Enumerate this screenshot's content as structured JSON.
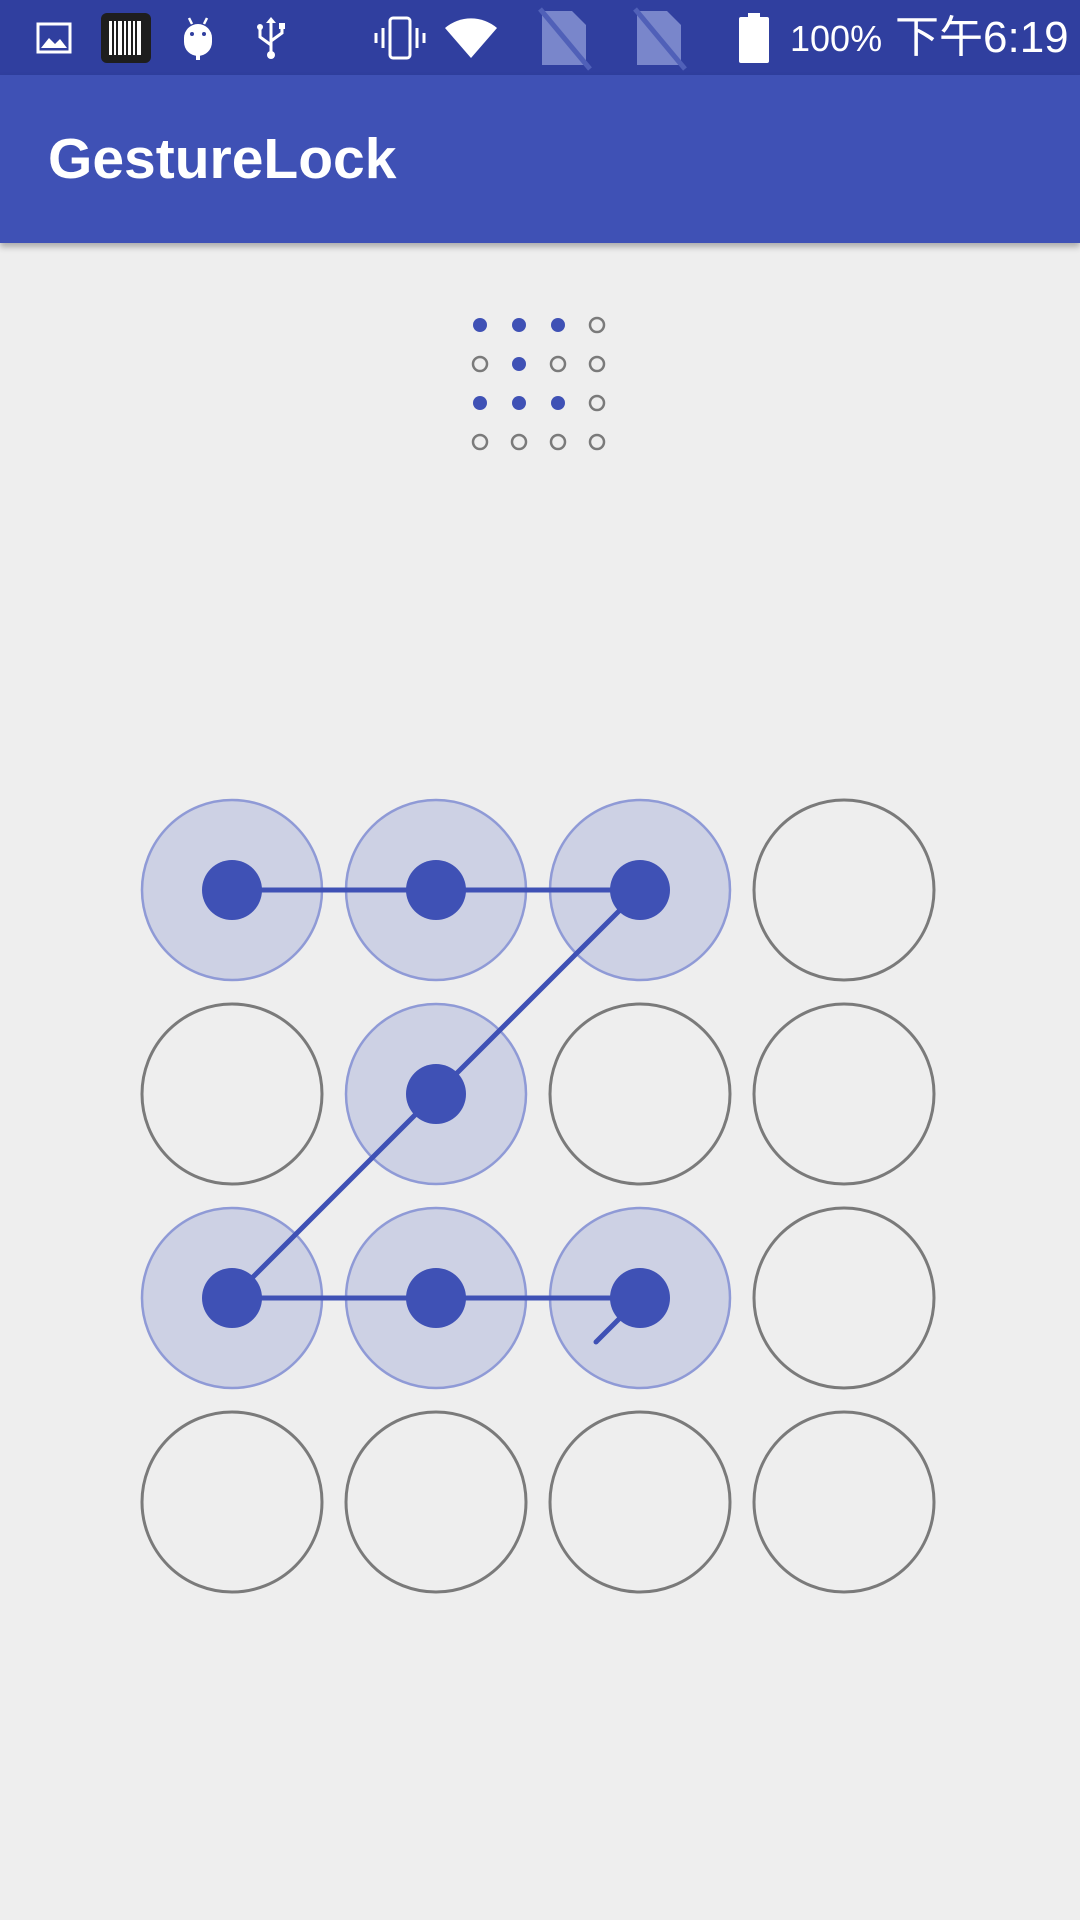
{
  "status_bar": {
    "icons": [
      "gallery-icon",
      "barcode-icon",
      "android-icon",
      "usb-icon",
      "vibrate-icon",
      "wifi-icon",
      "no-sim-icon",
      "no-sim-icon",
      "battery-icon"
    ],
    "battery_text": "100%",
    "clock": "下午6:19"
  },
  "app_bar": {
    "title": "GestureLock"
  },
  "colors": {
    "status_bar": "#303f9f",
    "app_bar": "#3f51b5",
    "accent": "#3f51b5",
    "selected_fill": "#cdd1e4",
    "selected_ring": "#8f9ad6",
    "unselected_ring": "#7a7a7a",
    "background": "#eeeeee"
  },
  "gesture": {
    "rows": 4,
    "cols": 4,
    "selected": [
      [
        true,
        true,
        true,
        false
      ],
      [
        false,
        true,
        false,
        false
      ],
      [
        true,
        true,
        true,
        false
      ],
      [
        false,
        false,
        false,
        false
      ]
    ],
    "path": [
      [
        0,
        0
      ],
      [
        0,
        1
      ],
      [
        0,
        2
      ],
      [
        1,
        1
      ],
      [
        2,
        0
      ],
      [
        2,
        1
      ],
      [
        2,
        2
      ]
    ],
    "trailing_direction": "down-left"
  }
}
